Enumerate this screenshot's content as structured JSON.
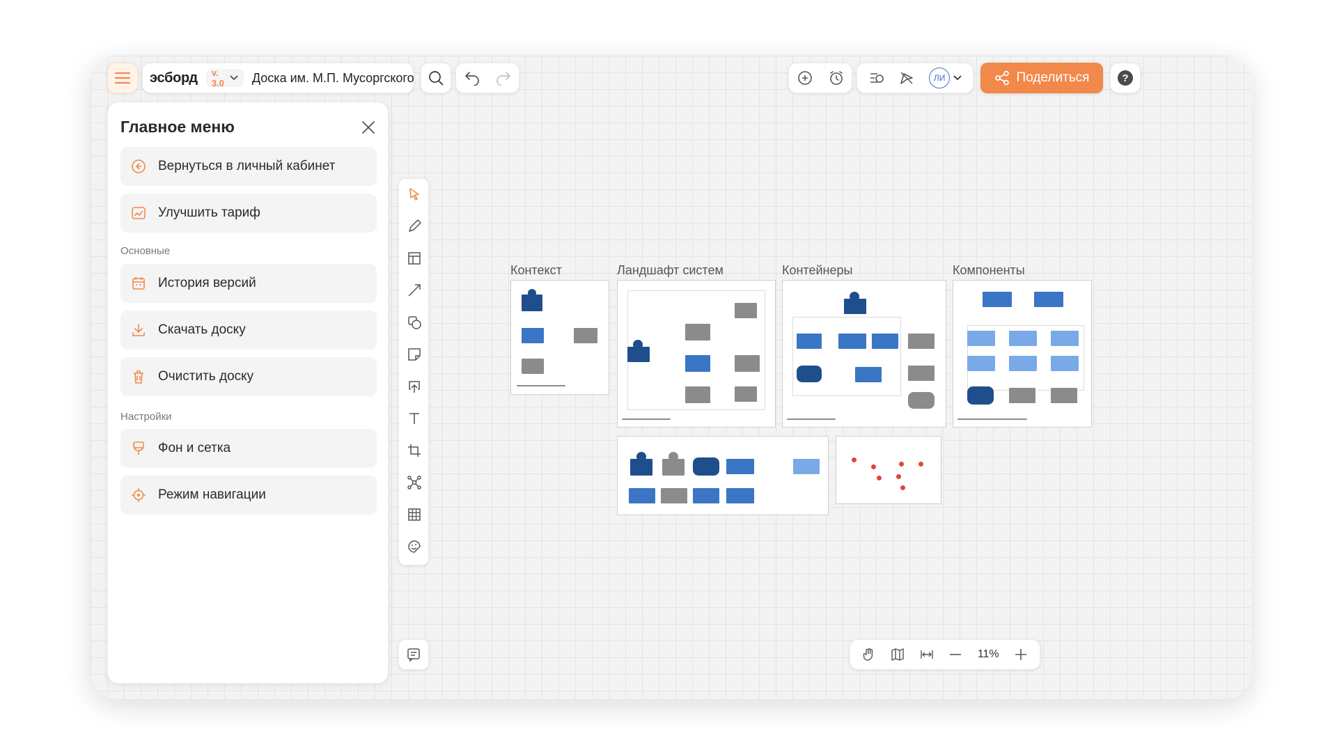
{
  "app": {
    "brand": "эсборд",
    "version": "v. 3.0",
    "board_name": "Доска им. М.П. Мусоргского",
    "user_initials": "ЛИ",
    "share_label": "Поделиться",
    "help_label": "?"
  },
  "menu": {
    "title": "Главное меню",
    "items_top": [
      {
        "label": "Вернуться в личный кабинет",
        "icon": "arrow-left-circle-icon"
      },
      {
        "label": "Улучшить тариф",
        "icon": "chart-upgrade-icon"
      }
    ],
    "section_main": "Основные",
    "items_main": [
      {
        "label": "История версий",
        "icon": "calendar-history-icon"
      },
      {
        "label": "Скачать доску",
        "icon": "download-icon"
      },
      {
        "label": "Очистить доску",
        "icon": "trash-icon"
      }
    ],
    "section_settings": "Настройки",
    "items_settings": [
      {
        "label": "Фон и сетка",
        "icon": "paint-roller-icon"
      },
      {
        "label": "Режим навигации",
        "icon": "target-icon"
      }
    ]
  },
  "canvas": {
    "frames": [
      {
        "title": "Контекст"
      },
      {
        "title": "Ландшафт систем"
      },
      {
        "title": "Контейнеры"
      },
      {
        "title": "Компоненты"
      }
    ]
  },
  "zoom": {
    "value": "11%"
  },
  "colors": {
    "accent": "#f2884a",
    "dark_blue": "#1f4e8c",
    "blue": "#3a75c6",
    "light_blue": "#7aa9e8",
    "gray": "#8b8b8b"
  }
}
